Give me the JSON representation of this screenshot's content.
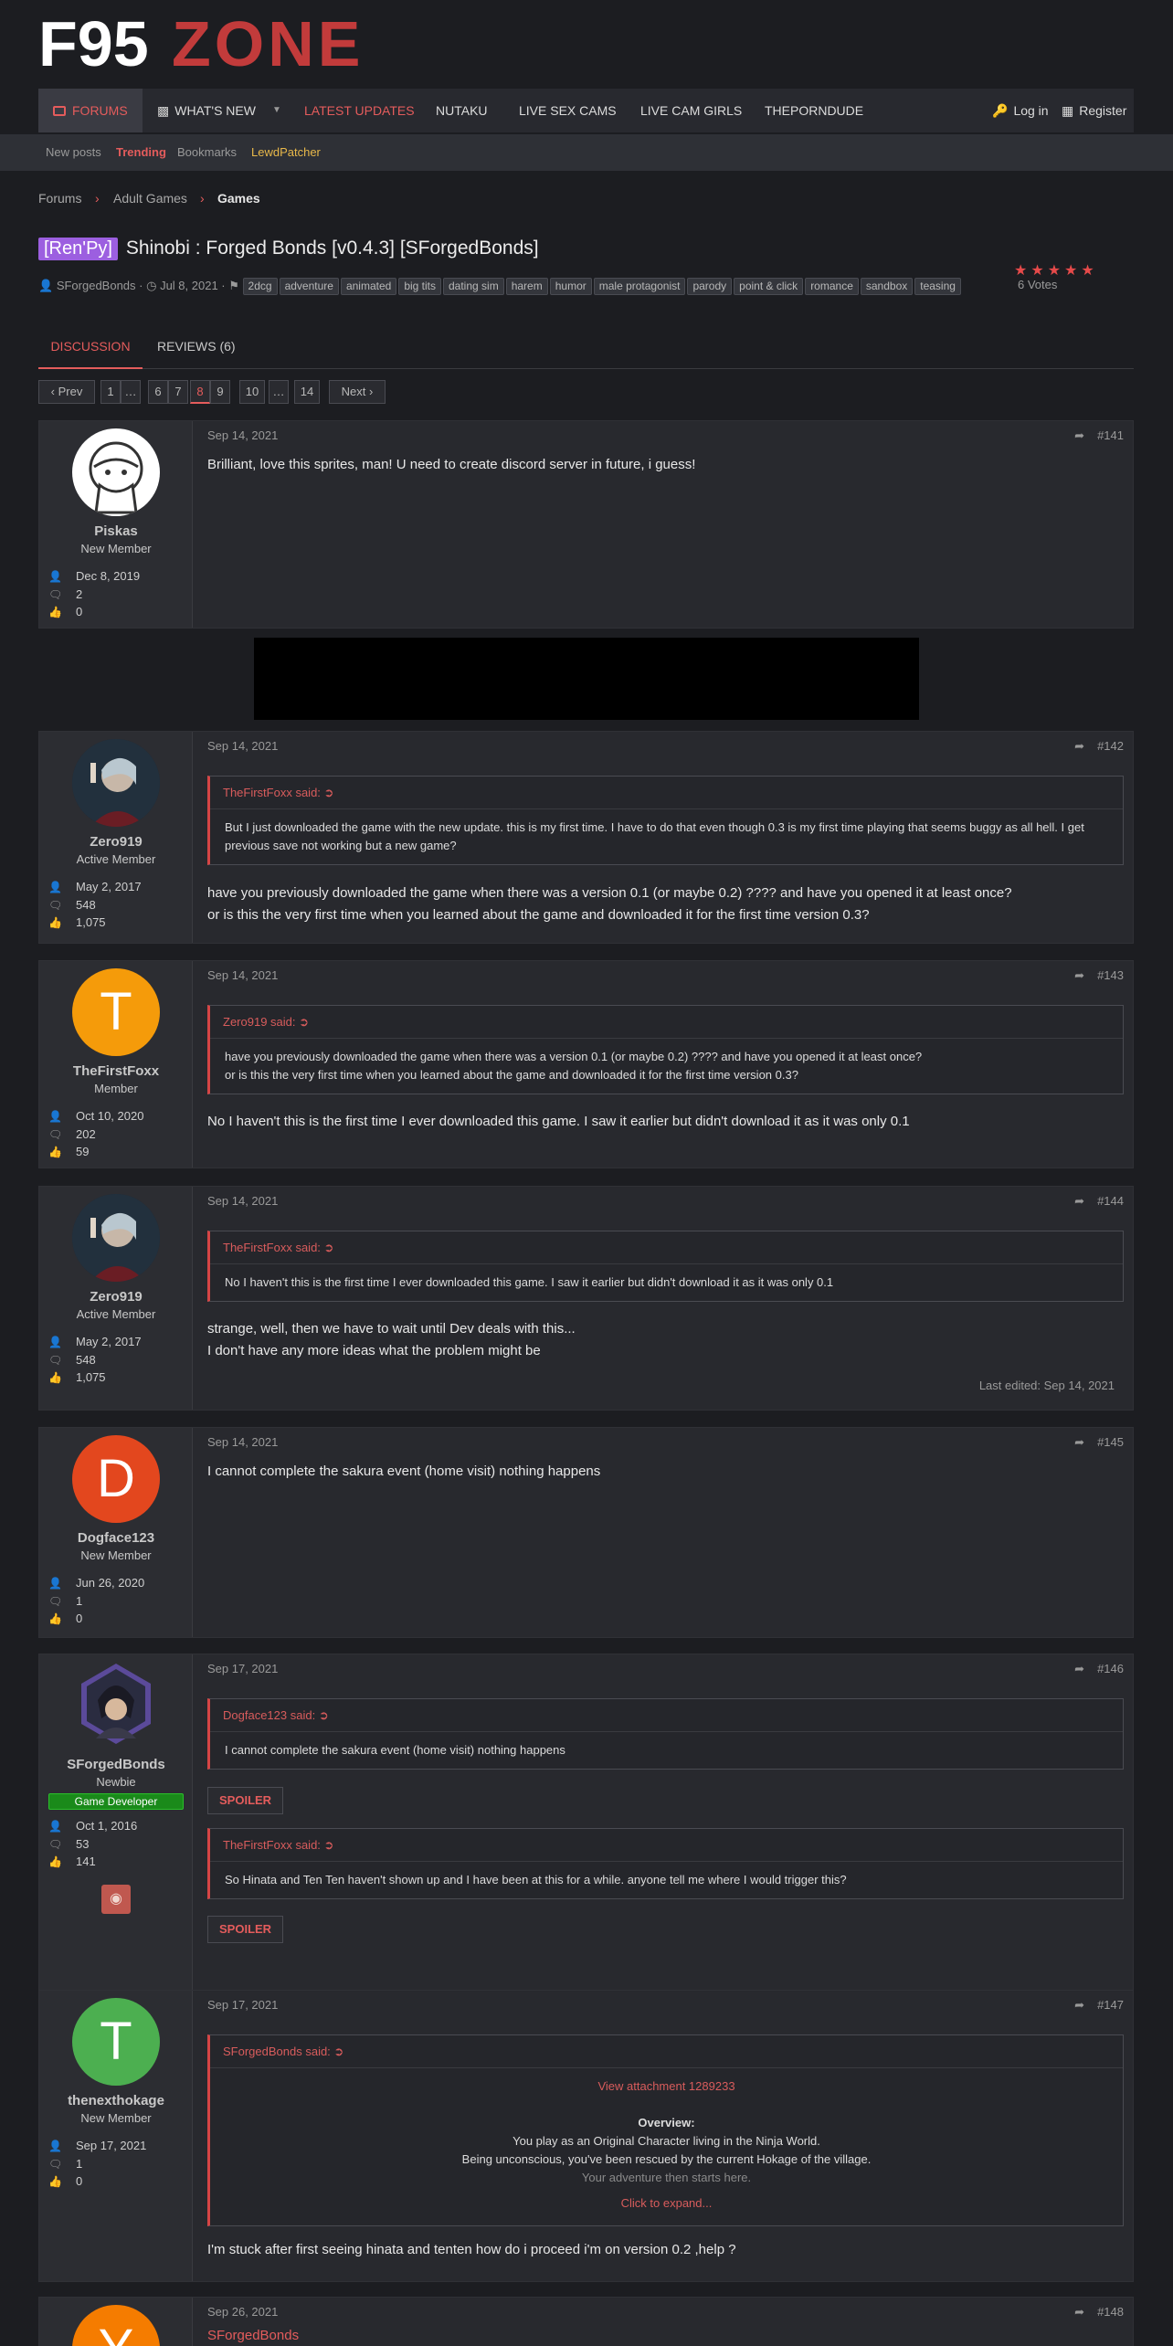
{
  "header": {
    "logo_text_1": "F95",
    "logo_text_2": "ZONE"
  },
  "nav": {
    "forums": "FORUMS",
    "whats_new": "WHAT'S NEW",
    "latest_updates": "LATEST UPDATES",
    "nutaku": "NUTAKU",
    "live_sex_cams": "LIVE SEX CAMS",
    "live_cam_girls": "LIVE CAM GIRLS",
    "theporndude": "THEPORNDUDE",
    "login": "Log in",
    "register": "Register"
  },
  "subnav": {
    "new_posts": "New posts",
    "trending": "Trending",
    "bookmarks": "Bookmarks",
    "lewdpatcher": "LewdPatcher"
  },
  "breadcrumb": {
    "forums": "Forums",
    "adult_games": "Adult Games",
    "games": "Games"
  },
  "thread": {
    "prefix": "[Ren'Py]",
    "title": "Shinobi : Forged Bonds [v0.4.3] [SForgedBonds]",
    "author": "SForgedBonds",
    "date": "Jul 8, 2021",
    "tags": [
      "2dcg",
      "adventure",
      "animated",
      "big tits",
      "dating sim",
      "harem",
      "humor",
      "male protagonist",
      "parody",
      "point & click",
      "romance",
      "sandbox",
      "teasing"
    ],
    "stars": "★★★★★",
    "votes": "6 Votes"
  },
  "tabs": {
    "discussion": "DISCUSSION",
    "reviews": "REVIEWS (6)"
  },
  "pager": {
    "prev": "Prev",
    "next": "Next",
    "pages": [
      "1",
      "…",
      "6",
      "7",
      "8",
      "9",
      "10",
      "…",
      "14"
    ],
    "current": "8"
  },
  "posts": [
    {
      "user": "Piskas",
      "title": "New Member",
      "joined": "Dec 8, 2019",
      "messages": "2",
      "reactions": "0",
      "date": "Sep 14, 2021",
      "num": "#141",
      "text": "Brilliant, love this sprites, man! U need to create discord server in future, i guess!"
    },
    {
      "user": "Zero919",
      "title": "Active Member",
      "joined": "May 2, 2017",
      "messages": "548",
      "reactions": "1,075",
      "date": "Sep 14, 2021",
      "num": "#142",
      "quote_author": "TheFirstFoxx said:",
      "quote": "But I just downloaded the game with the new update. this is my first time. I have to do that even though 0.3 is my first time playing that seems buggy as all hell. I get previous save not working but a new game?",
      "text1": "have you previously downloaded the game when there was a version 0.1 (or maybe 0.2) ???? and have you opened it at least once?",
      "text2": "or is this the very first time when you learned about the game and downloaded it for the first time version 0.3?"
    },
    {
      "user": "TheFirstFoxx",
      "title": "Member",
      "letter": "T",
      "joined": "Oct 10, 2020",
      "messages": "202",
      "reactions": "59",
      "date": "Sep 14, 2021",
      "num": "#143",
      "quote_author": "Zero919 said:",
      "quote1": "have you previously downloaded the game when there was a version 0.1 (or maybe 0.2) ???? and have you opened it at least once?",
      "quote2": "or is this the very first time when you learned about the game and downloaded it for the first time version 0.3?",
      "text": "No I haven't this is the first time I ever downloaded this game. I saw it earlier but didn't download it as it was only 0.1"
    },
    {
      "user": "Zero919",
      "title": "Active Member",
      "joined": "May 2, 2017",
      "messages": "548",
      "reactions": "1,075",
      "date": "Sep 14, 2021",
      "num": "#144",
      "quote_author": "TheFirstFoxx said:",
      "quote": "No I haven't this is the first time I ever downloaded this game. I saw it earlier but didn't download it as it was only 0.1",
      "text1": "strange, well, then we have to wait until Dev deals with this...",
      "text2": "I don't have any more ideas what the problem might be",
      "edited": "Last edited: Sep 14, 2021"
    },
    {
      "user": "Dogface123",
      "title": "New Member",
      "letter": "D",
      "joined": "Jun 26, 2020",
      "messages": "1",
      "reactions": "0",
      "date": "Sep 14, 2021",
      "num": "#145",
      "text": "I cannot complete the sakura event (home visit) nothing happens"
    },
    {
      "user": "SForgedBonds",
      "title": "Newbie",
      "badge": "Game Developer",
      "joined": "Oct 1, 2016",
      "messages": "53",
      "reactions": "141",
      "date": "Sep 17, 2021",
      "num": "#146",
      "quote_author": "Dogface123 said:",
      "quote": "I cannot complete the sakura event (home visit) nothing happens",
      "spoiler": "SPOILER",
      "quote2_author": "TheFirstFoxx said:",
      "quote2": "So Hinata and Ten Ten haven't shown up and I have been at this for a while. anyone tell me where I would trigger this?"
    },
    {
      "user": "thenexthokage",
      "title": "New Member",
      "letter": "T",
      "joined": "Sep 17, 2021",
      "messages": "1",
      "reactions": "0",
      "date": "Sep 17, 2021",
      "num": "#147",
      "quote_author": "SForgedBonds said:",
      "attachment": "View attachment 1289233",
      "overview": "Overview:",
      "ov1": "You play as an Original Character living in the Ninja World.",
      "ov2": "Being unconscious, you've been rescued by the current Hokage of the village.",
      "ov3": "Your adventure then starts here.",
      "expand": "Click to expand...",
      "text": "I'm stuck after first seeing hinata and tenten how do i proceed i'm on version 0.2 ,help ?"
    },
    {
      "letter": "Y",
      "date": "Sep 26, 2021",
      "num": "#148",
      "author_link": "SForgedBonds"
    }
  ],
  "colors": {
    "accent": "#e45c5c",
    "background": "#1c1d21",
    "panel": "#28292e",
    "prefix": "#9c5fe0",
    "dev_badge": "#1a8a1a"
  }
}
